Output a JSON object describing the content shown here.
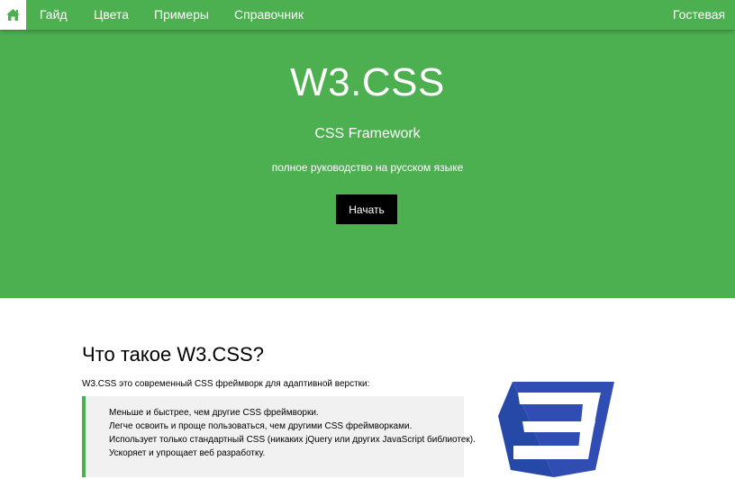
{
  "nav": {
    "home_icon": "home-icon",
    "items": [
      {
        "label": "Гайд"
      },
      {
        "label": "Цвета"
      },
      {
        "label": "Примеры"
      },
      {
        "label": "Справочник"
      }
    ],
    "guestbook": "Гостевая"
  },
  "hero": {
    "title": "W3.CSS",
    "subtitle": "CSS Framework",
    "tagline": "полное руководство на русском языке",
    "start_button": "Начать"
  },
  "intro": {
    "heading": "Что такое W3.CSS?",
    "text": "W3.CSS это современный CSS фреймворк для адаптивной верстки:",
    "features": [
      "Меньше и быстрее, чем другие CSS фреймворки.",
      "Легче освоить и проще пользоваться, чем другими CSS фреймворками.",
      "Использует только стандартный CSS (никаких jQuery или других JavaScript библиотек).",
      "Ускоряет и упрощает веб разработку."
    ]
  },
  "colors": {
    "accent": "#4caf50",
    "logo_blue": "#2f4db3"
  }
}
